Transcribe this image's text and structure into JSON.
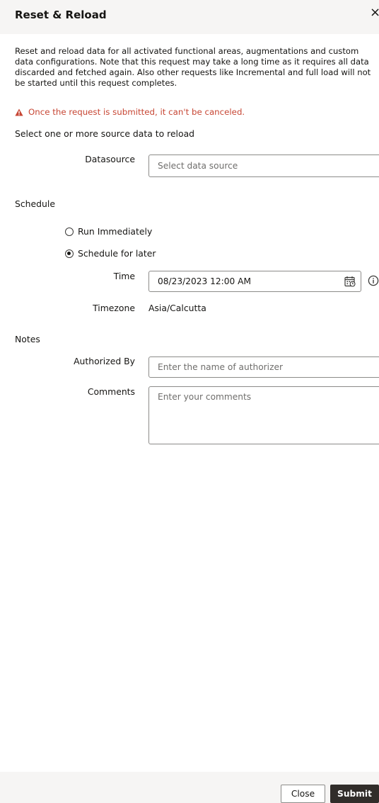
{
  "dialog": {
    "title": "Reset & Reload",
    "close_glyph": "×",
    "description": "Reset and reload data for all activated functional areas, augmentations and custom data configurations. Note that this request may take a long time as it requires all data discarded and fetched again. Also other requests like Incremental and full load will not be started until this request completes.",
    "warning": "Once the request is submitted, it can't be canceled.",
    "warning_icon": "warning-triangle-icon",
    "warning_color": "#c74634"
  },
  "source": {
    "heading": "Select one or more source data to reload",
    "datasource_label": "Datasource",
    "datasource_placeholder": "Select data source"
  },
  "schedule": {
    "heading": "Schedule",
    "options": [
      {
        "label": "Run Immediately",
        "checked": false
      },
      {
        "label": "Schedule for later",
        "checked": true
      }
    ],
    "time_label": "Time",
    "time_value": "08/23/2023 12:00 AM",
    "calendar_icon": "calendar-icon",
    "info_icon": "info-icon",
    "timezone_label": "Timezone",
    "timezone_value": "Asia/Calcutta"
  },
  "notes": {
    "heading": "Notes",
    "authorized_label": "Authorized By",
    "authorized_placeholder": "Enter the name of authorizer",
    "comments_label": "Comments",
    "comments_placeholder": "Enter your comments"
  },
  "footer": {
    "close_label": "Close",
    "submit_label": "Submit",
    "submit_color": "#312d2a"
  }
}
